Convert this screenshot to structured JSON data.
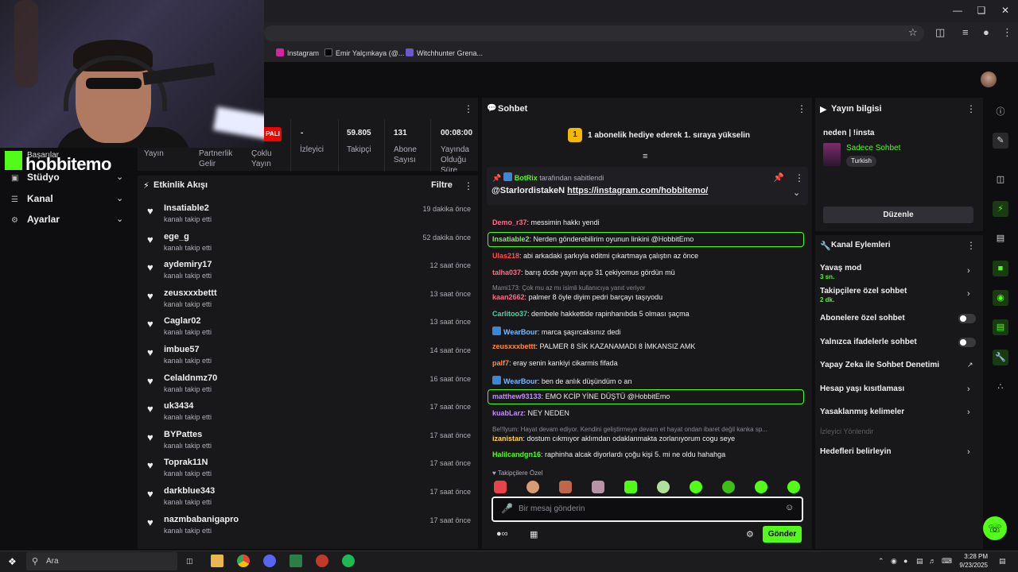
{
  "bookmarks": [
    {
      "label": "Instagram",
      "color": "#d6249f"
    },
    {
      "label": "Emir Yalçınkaya (@...",
      "color": "#000000"
    },
    {
      "label": "Witchhunter Grena...",
      "color": "#6a5acd"
    }
  ],
  "overlay": {
    "logo": "hobbitemo",
    "basarilar": "Başarılar"
  },
  "nav": [
    {
      "label": "Stüdyo"
    },
    {
      "label": "Kanal"
    },
    {
      "label": "Ayarlar"
    }
  ],
  "stats": {
    "pali": "PALI",
    "cols": [
      {
        "value": "",
        "label": "Yayın"
      },
      {
        "value": "",
        "label": "Partnerlik Gelir"
      },
      {
        "value": "",
        "label": "Çoklu Yayın"
      },
      {
        "value": "-",
        "label": "İzleyici"
      },
      {
        "value": "59.805",
        "label": "Takipçi"
      },
      {
        "value": "131",
        "label": "Abone Sayısı"
      },
      {
        "value": "00:08:00",
        "label": "Yayında Olduğu Süre"
      }
    ]
  },
  "feed": {
    "title": "Etkinlik Akışı",
    "filter": "Filtre",
    "items": [
      {
        "name": "Insatiable2",
        "sub": "kanalı takip etti",
        "time": "19 dakika önce"
      },
      {
        "name": "ege_g",
        "sub": "kanalı takip etti",
        "time": "52 dakika önce"
      },
      {
        "name": "aydemiry17",
        "sub": "kanalı takip etti",
        "time": "12 saat önce"
      },
      {
        "name": "zeusxxxbettt",
        "sub": "kanalı takip etti",
        "time": "13 saat önce"
      },
      {
        "name": "Caglar02",
        "sub": "kanalı takip etti",
        "time": "13 saat önce"
      },
      {
        "name": "imbue57",
        "sub": "kanalı takip etti",
        "time": "14 saat önce"
      },
      {
        "name": "Celaldnmz70",
        "sub": "kanalı takip etti",
        "time": "16 saat önce"
      },
      {
        "name": "uk3434",
        "sub": "kanalı takip etti",
        "time": "17 saat önce"
      },
      {
        "name": "BYPattes",
        "sub": "kanalı takip etti",
        "time": "17 saat önce"
      },
      {
        "name": "Toprak11N",
        "sub": "kanalı takip etti",
        "time": "17 saat önce"
      },
      {
        "name": "darkblue343",
        "sub": "kanalı takip etti",
        "time": "17 saat önce"
      },
      {
        "name": "nazmbabanigapro",
        "sub": "kanalı takip etti",
        "time": "17 saat önce"
      }
    ]
  },
  "chat": {
    "title": "Sohbet",
    "goal_rank": "1",
    "goal": "1 abonelik hediye ederek 1. sıraya yükselin",
    "pinned_by_user": "BotRix",
    "pinned_by_text": "tarafından sabitlendi",
    "pinned_prefix": "@StarlordistakeN",
    "pinned_link": "https://instagram.com/hobbitemo/",
    "messages": [
      {
        "user": "Demo_r37",
        "color": "#ff6b8b",
        "text": "messimin hakkı yendi",
        "hl": false,
        "badge": false
      },
      {
        "user": "Insatiable2",
        "color": "#8fe36a",
        "text": "Nerden gönderebilirim oyunun linkini @HobbitEmo",
        "hl": true,
        "badge": false
      },
      {
        "user": "Ulas218",
        "color": "#ff4d4d",
        "text": "abi arkadaki şarkıyla editmi çıkartmaya çalıştın az önce",
        "hl": false,
        "badge": false
      },
      {
        "user": "talha037",
        "color": "#ff6b8b",
        "text": "barış dcde yayın açıp 31 çekiyomus gördün mü",
        "hl": false,
        "badge": false
      },
      {
        "user": "kaan2662",
        "color": "#ff6b8b",
        "text": "palmer 8 öyle diyim pedri barçayı taşıyodu",
        "hl": false,
        "badge": false,
        "reply": "Mami173: Çok mu az mı isimli kullanıcıya yanıt veriyor"
      },
      {
        "user": "Carlitoo37",
        "color": "#53d1a0",
        "text": "dembele hakkettide rapinhanıbda 5 olması şaçma",
        "hl": false,
        "badge": false
      },
      {
        "user": "WearBour",
        "color": "#7ab8ff",
        "text": "marca şaşırcaksınız dedi",
        "hl": false,
        "badge": true
      },
      {
        "user": "zeusxxxbettt",
        "color": "#ff8c42",
        "text": "PALMER 8 SİK KAZANAMADI 8 İMKANSIZ AMK",
        "hl": false,
        "badge": false
      },
      {
        "user": "palf7",
        "color": "#ff8c42",
        "text": "eray senin kankiyi cikarmis fifada",
        "hl": false,
        "badge": false
      },
      {
        "user": "WearBour",
        "color": "#7ab8ff",
        "text": "ben de anlık düşündüm o an",
        "hl": false,
        "badge": true
      },
      {
        "user": "matthew93133",
        "color": "#c38cff",
        "text": "EMO KCİP YİNE DÜŞTÜ @HobbitEmo",
        "hl": true,
        "badge": false
      },
      {
        "user": "kuabLarz",
        "color": "#c38cff",
        "text": "NEY NEDEN",
        "hl": false,
        "badge": false
      },
      {
        "user": "izanistan",
        "color": "#ffd24d",
        "text": "dostum cıkmıyor aklımdan odaklanmakta zorlanıyorum cogu seye",
        "hl": false,
        "badge": false,
        "reply": "Be!!lyum: Hayat devam ediyor. Kendini geliştirmeye devam et hayat ondan ibaret değil kanka sp..."
      },
      {
        "user": "Halilcandgn16",
        "color": "#53fc18",
        "text": "raphinha alcak diyorlardı çoğu kişi 5. mi ne oldu hahahga",
        "hl": false,
        "badge": false
      }
    ],
    "followers_only": "Takipçilere Özel",
    "placeholder": "Bir mesaj gönderin",
    "send": "Gönder"
  },
  "info": {
    "title": "Yayın bilgisi",
    "stream_title": "neden | !insta",
    "category": "Sadece Sohbet",
    "tag": "Turkish",
    "edit": "Düzenle"
  },
  "actions": {
    "title": "Kanal Eylemleri",
    "items": [
      {
        "label": "Yavaş mod",
        "sub": "3 sn.",
        "kind": "chev"
      },
      {
        "label": "Takipçilere özel sohbet",
        "sub": "2 dk.",
        "kind": "chev"
      },
      {
        "label": "Abonelere özel sohbet",
        "sub": "",
        "kind": "toggle"
      },
      {
        "label": "Yalnızca ifadelerle sohbet",
        "sub": "",
        "kind": "toggle"
      },
      {
        "label": "Yapay Zeka ile Sohbet Denetimi",
        "sub": "",
        "kind": "ext"
      },
      {
        "label": "Hesap yaşı kısıtlaması",
        "sub": "",
        "kind": "chev"
      },
      {
        "label": "Yasaklanmış kelimeler",
        "sub": "",
        "kind": "chev"
      },
      {
        "label": "İzleyici Yönlendir",
        "sub": "",
        "kind": "dim"
      },
      {
        "label": "Hedefleri belirleyin",
        "sub": "",
        "kind": "chev"
      }
    ]
  },
  "taskbar": {
    "search": "Ara",
    "time": "3:28 PM",
    "date": "9/23/2025"
  }
}
